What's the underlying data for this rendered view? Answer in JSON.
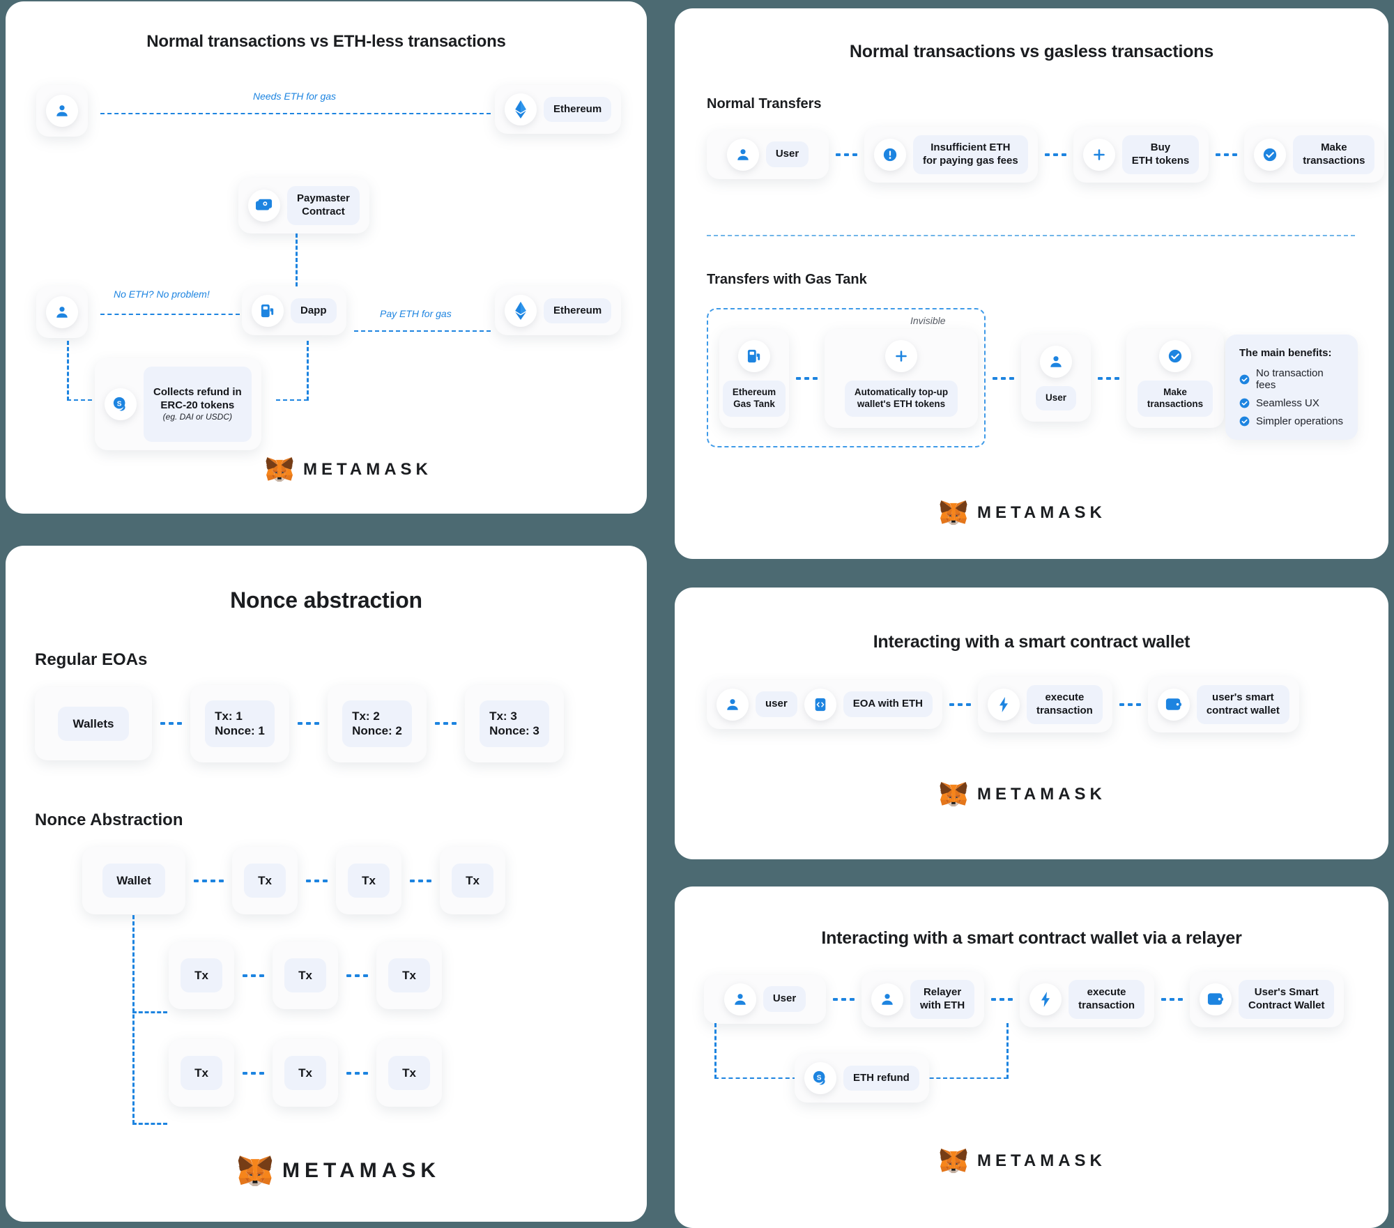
{
  "background_color": "#4c6a72",
  "accent_color": "#1d84e0",
  "brand": {
    "name": "METAMASK"
  },
  "panel1": {
    "title": "Normal transactions vs ETH-less transactions",
    "edge_labels": {
      "needs_eth": "Needs ETH for gas",
      "no_eth": "No ETH? No problem!",
      "pay_eth": "Pay ETH for gas"
    },
    "nodes": {
      "user_top": {
        "icon": "user-icon",
        "label": ""
      },
      "ethereum_top": {
        "icon": "ethereum-icon",
        "label": "Ethereum"
      },
      "paymaster": {
        "icon": "money-icon",
        "label": "Paymaster\nContract"
      },
      "user_bottom": {
        "icon": "user-icon",
        "label": ""
      },
      "dapp": {
        "icon": "gas-pump-icon",
        "label": "Dapp"
      },
      "ethereum_bottom": {
        "icon": "ethereum-icon",
        "label": "Ethereum"
      },
      "refund": {
        "icon": "coin-icon",
        "label": "Collects refund in\nERC-20 tokens",
        "sub": "(eg. DAI or USDC)"
      }
    }
  },
  "panel2": {
    "title": "Normal transactions vs gasless transactions",
    "section_normal": "Normal Transfers",
    "section_gastank": "Transfers with Gas Tank",
    "invisible_tag": "Invisible",
    "normal_steps": [
      {
        "icon": "user-icon",
        "label": "User"
      },
      {
        "icon": "alert-icon",
        "label": "Insufficient ETH\nfor paying gas fees"
      },
      {
        "icon": "plus-icon",
        "label": "Buy\nETH tokens"
      },
      {
        "icon": "check-icon",
        "label": "Make\ntransactions"
      }
    ],
    "gastank_steps": [
      {
        "icon": "gas-pump-icon",
        "label": "Ethereum\nGas Tank"
      },
      {
        "icon": "plus-icon",
        "label": "Automatically top-up\nwallet's ETH tokens"
      },
      {
        "icon": "user-icon",
        "label": "User"
      },
      {
        "icon": "check-icon",
        "label": "Make\ntransactions"
      }
    ],
    "benefits": {
      "heading": "The main benefits:",
      "items": [
        "No transaction fees",
        "Seamless UX",
        "Simpler operations"
      ]
    }
  },
  "panel3": {
    "title": "Nonce abstraction",
    "section_regular": "Regular EOAs",
    "section_abstraction": "Nonce Abstraction",
    "regular_nodes": [
      {
        "label": "Wallets"
      },
      {
        "label": "Tx: 1\nNonce: 1"
      },
      {
        "label": "Tx: 2\nNonce: 2"
      },
      {
        "label": "Tx: 3\nNonce: 3"
      }
    ],
    "abstraction_rows": [
      [
        {
          "label": "Wallet"
        },
        {
          "label": "Tx"
        },
        {
          "label": "Tx"
        },
        {
          "label": "Tx"
        }
      ],
      [
        {
          "label": "Tx"
        },
        {
          "label": "Tx"
        },
        {
          "label": "Tx"
        }
      ],
      [
        {
          "label": "Tx"
        },
        {
          "label": "Tx"
        },
        {
          "label": "Tx"
        }
      ]
    ]
  },
  "panel4": {
    "title": "Interacting with a smart contract wallet",
    "steps": [
      {
        "icon": "user-icon",
        "label": "user"
      },
      {
        "icon": "code-icon",
        "label": "EOA with ETH"
      },
      {
        "icon": "bolt-icon",
        "label": "execute\ntransaction"
      },
      {
        "icon": "wallet-icon",
        "label": "user's smart\ncontract wallet"
      }
    ]
  },
  "panel5": {
    "title": "Interacting with a smart contract wallet via a relayer",
    "steps": [
      {
        "icon": "user-icon",
        "label": "User"
      },
      {
        "icon": "user-icon",
        "label": "Relayer\nwith ETH"
      },
      {
        "icon": "bolt-icon",
        "label": "execute\ntransaction"
      },
      {
        "icon": "wallet-icon",
        "label": "User's Smart\nContract Wallet"
      }
    ],
    "refund": {
      "icon": "coin-icon",
      "label": "ETH refund"
    }
  }
}
